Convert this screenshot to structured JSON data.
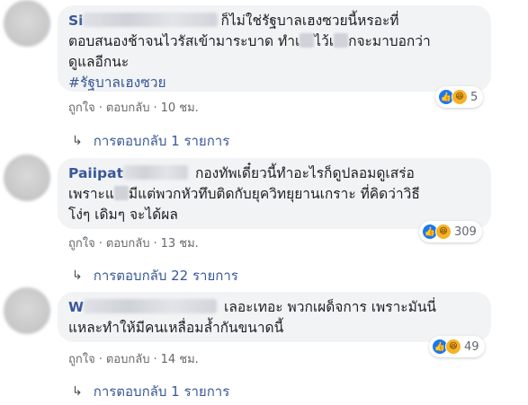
{
  "comments": [
    {
      "author": "Si",
      "text_line1": "ก็ไม่ใช่รัฐบาลเฮงซวยนี้หรอะที่",
      "text_line2": "ตอบสนองช้าจนไวรัสเข้ามาระบาด ทำเ",
      "text_line2b": "ไว้เ",
      "text_line2c": "กจะมาบอกว่า",
      "text_line3": "ดูแลอีกนะ",
      "hashtag": "#รัฐบาลเฮงซวย",
      "reaction_count": "5",
      "like_label": "ถูกใจ",
      "reply_label": "ตอบกลับ",
      "time": "10 ชม.",
      "replies_label": "การตอบกลับ 1 รายการ"
    },
    {
      "author": "Paiipat",
      "text_line1": "กองทัพเดี๋ยวนี้ทำอะไรก็ดูปลอมดูเสร่อ",
      "text_line2a": "เพราะแ",
      "text_line2": "มีแต่พวกหัวทึบติดกับยุควิทยุยานเกราะ ที่คิดว่าวิธี",
      "text_line3": "โง่ๆ เดิมๆ จะได้ผล",
      "reaction_count": "309",
      "like_label": "ถูกใจ",
      "reply_label": "ตอบกลับ",
      "time": "13 ชม.",
      "replies_label": "การตอบกลับ 22 รายการ"
    },
    {
      "author": "W",
      "text_line1": "เลอะเทอะ พวกเผด็จการ เพราะมันนี่",
      "text_line2": "แหละทำให้มีคนเหลื่อมล้ำกันขนาดนี้",
      "reaction_count": "49",
      "like_label": "ถูกใจ",
      "reply_label": "ตอบกลับ",
      "time": "14 ชม.",
      "replies_label": "การตอบกลับ 1 รายการ"
    }
  ],
  "icons": {
    "like": "thumbs-up-icon",
    "haha": "laughing-face-icon",
    "reply_arrow": "reply-arrow-icon"
  },
  "colors": {
    "link": "#385898",
    "bubble": "#f2f3f5",
    "like_blue": "#1877f2",
    "haha_yellow": "#f7b125"
  }
}
